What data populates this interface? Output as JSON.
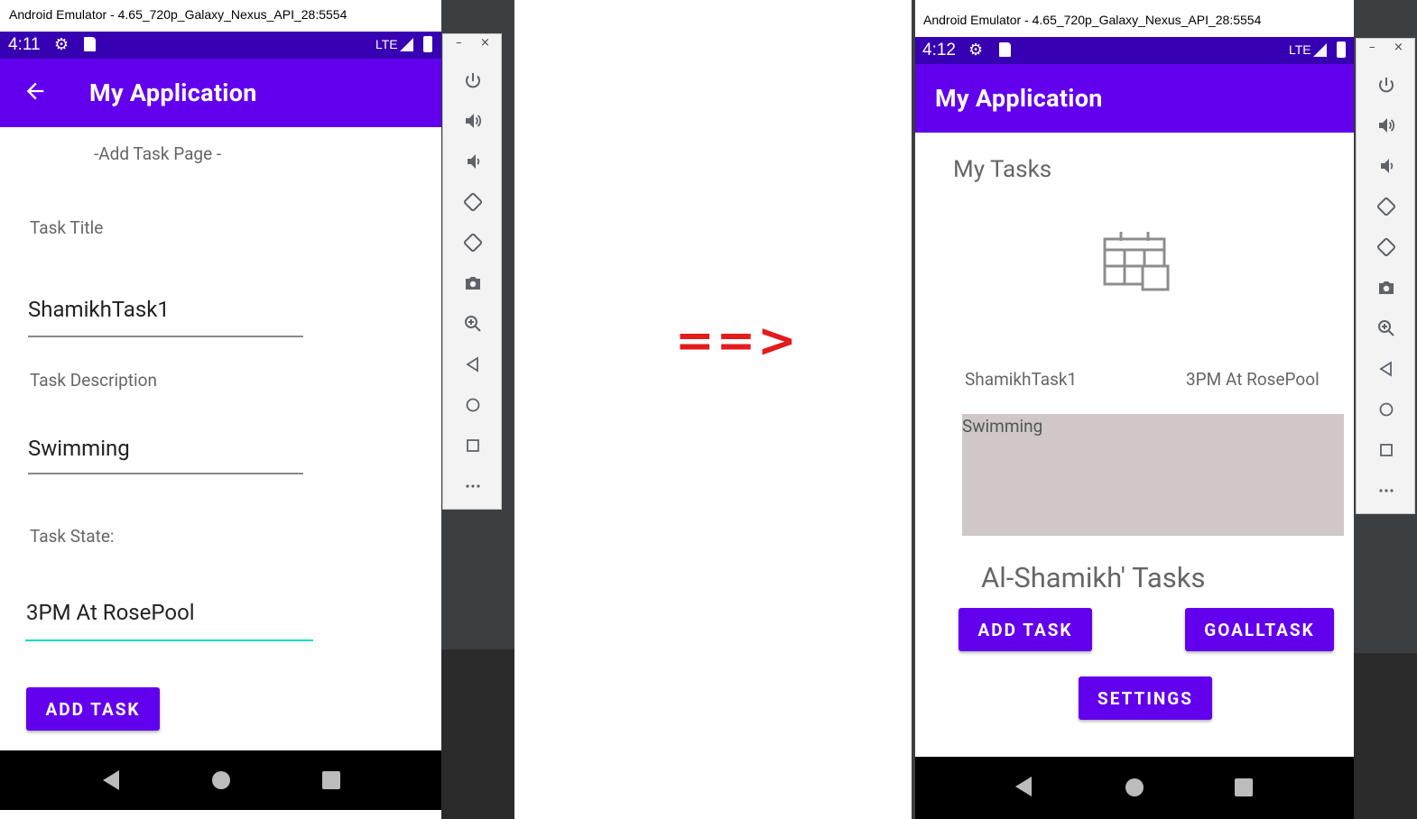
{
  "left_emulator": {
    "window_title": "Android Emulator - 4.65_720p_Galaxy_Nexus_API_28:5554",
    "status": {
      "time": "4:11",
      "network": "LTE"
    },
    "app_bar": {
      "title": "My Application",
      "back_icon": "arrow-back-icon"
    },
    "page_header": "-Add Task Page -",
    "task_title_label": "Task Title",
    "task_title_value": "ShamikhTask1",
    "task_description_label": "Task Description",
    "task_description_value": "Swimming",
    "task_state_label": "Task State:",
    "task_state_value": "3PM At RosePool",
    "add_task_button": "ADD TASK"
  },
  "arrow": "==>",
  "right_emulator": {
    "window_title": "Android Emulator - 4.65_720p_Galaxy_Nexus_API_28:5554",
    "status": {
      "time": "4:12",
      "network": "LTE"
    },
    "app_bar": {
      "title": "My Application"
    },
    "heading": "My Tasks",
    "calendar_icon": "calendar-grid-icon",
    "task": {
      "title": "ShamikhTask1",
      "state": "3PM At RosePool",
      "description": "Swimming"
    },
    "owner_label": "Al-Shamikh' Tasks",
    "add_task_button": "ADD TASK",
    "goal_task_button": "GOALLTASK",
    "settings_button": "SETTINGS"
  },
  "toolbar_icons": [
    "power-icon",
    "volume-up-icon",
    "volume-down-icon",
    "rotate-left-icon",
    "rotate-right-icon",
    "camera-icon",
    "zoom-icon",
    "back-icon",
    "home-icon",
    "overview-icon",
    "more-icon"
  ],
  "colors": {
    "primary": "#6200ee",
    "primary_dark": "#3700b3",
    "accent": "#03dac5",
    "arrow": "#e31b1b",
    "description_bg": "#d0c8c8"
  }
}
